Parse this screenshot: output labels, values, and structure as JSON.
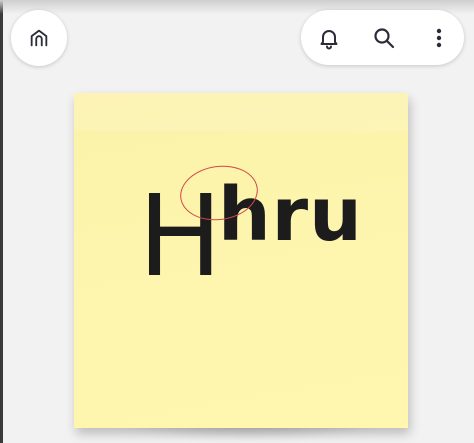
{
  "app_bar": {
    "home_icon": "home-icon",
    "actions": [
      {
        "icon": "bell-icon"
      },
      {
        "icon": "search-icon"
      },
      {
        "icon": "more-vertical-icon"
      }
    ]
  },
  "sticky_note": {
    "text_main": "H",
    "text_suffix": "hru",
    "note_color": "#fdf4ac",
    "annotation_color": "#d24848"
  }
}
